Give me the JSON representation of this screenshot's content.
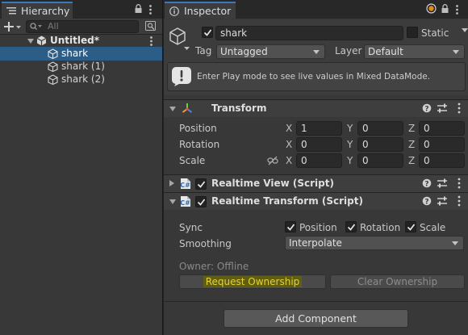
{
  "hierarchy": {
    "tab_label": "Hierarchy",
    "search_placeholder": "All",
    "scene_name": "Untitled*",
    "items": [
      {
        "label": "shark",
        "selected": true
      },
      {
        "label": "shark (1)",
        "selected": false
      },
      {
        "label": "shark (2)",
        "selected": false
      }
    ]
  },
  "inspector": {
    "tab_label": "Inspector",
    "object": {
      "active": true,
      "name": "shark",
      "static_label": "Static",
      "static_checked": false,
      "tag_label": "Tag",
      "tag_value": "Untagged",
      "layer_label": "Layer",
      "layer_value": "Default"
    },
    "info_message": "Enter Play mode to see live values in Mixed DataMode.",
    "transform": {
      "title": "Transform",
      "rows": [
        {
          "label": "Position",
          "x": "1",
          "y": "0",
          "z": "0"
        },
        {
          "label": "Rotation",
          "x": "0",
          "y": "0",
          "z": "0"
        },
        {
          "label": "Scale",
          "x": "0",
          "y": "0",
          "z": "0"
        }
      ],
      "axis_x": "X",
      "axis_y": "Y",
      "axis_z": "Z"
    },
    "realtime_view": {
      "title": "Realtime View (Script)",
      "enabled": true
    },
    "realtime_transform": {
      "title": "Realtime Transform (Script)",
      "enabled": true,
      "sync_label": "Sync",
      "sync_position": "Position",
      "sync_rotation": "Rotation",
      "sync_scale": "Scale",
      "smoothing_label": "Smoothing",
      "smoothing_value": "Interpolate",
      "owner_status": "Owner: Offline",
      "request_ownership": "Request Ownership",
      "clear_ownership": "Clear Ownership"
    },
    "add_component": "Add Component"
  },
  "colors": {
    "selection": "#2c5d87",
    "tab_accent": "#3a79bb",
    "highlight": "#5f5e12",
    "highlight_text": "#e4d23a"
  }
}
